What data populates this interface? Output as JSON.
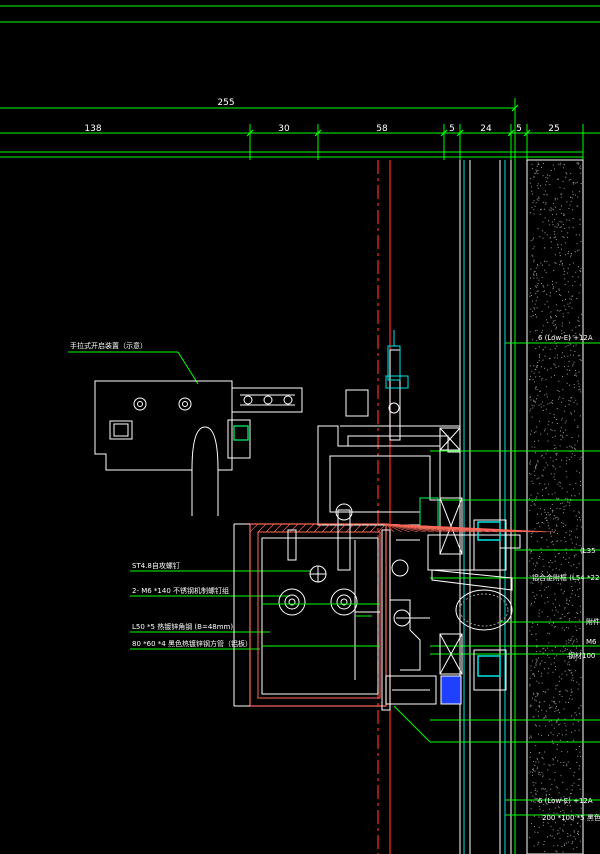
{
  "colors": {
    "background": "#000000",
    "dimension": "#00ff00",
    "geometry": "#ffffff",
    "glass": "#00e5e5",
    "axis_red": "#ff2a2a",
    "section": "#ff6a5a",
    "sealant": "#2040ff",
    "leader": "#00ff00"
  },
  "dimensions": {
    "overall": "255",
    "segments": [
      "138",
      "30",
      "58",
      "5",
      "24",
      "5",
      "25"
    ]
  },
  "callouts": {
    "left_top": "手拉式开启装置（示意）",
    "bolt": "ST4.8自攻螺钉",
    "m6": "2- M6 *140 不锈钢机制螺钉组",
    "angle": "L50 *5 热镀锌角钢 (B=48mm)",
    "tube": "80 *60 *4 黑色热镀锌钢方管（铝板）",
    "right_l35": "(L35",
    "right_al": "铝合金附框 (L54 *22",
    "right_a": "附件",
    "right_m6": "M6",
    "right_dim": "钢材100",
    "glass_top": "6 (Low-E) +12A",
    "glass_bottom": "6 (Low-E) +12A",
    "beam": "200 *100 *5 黑色"
  }
}
